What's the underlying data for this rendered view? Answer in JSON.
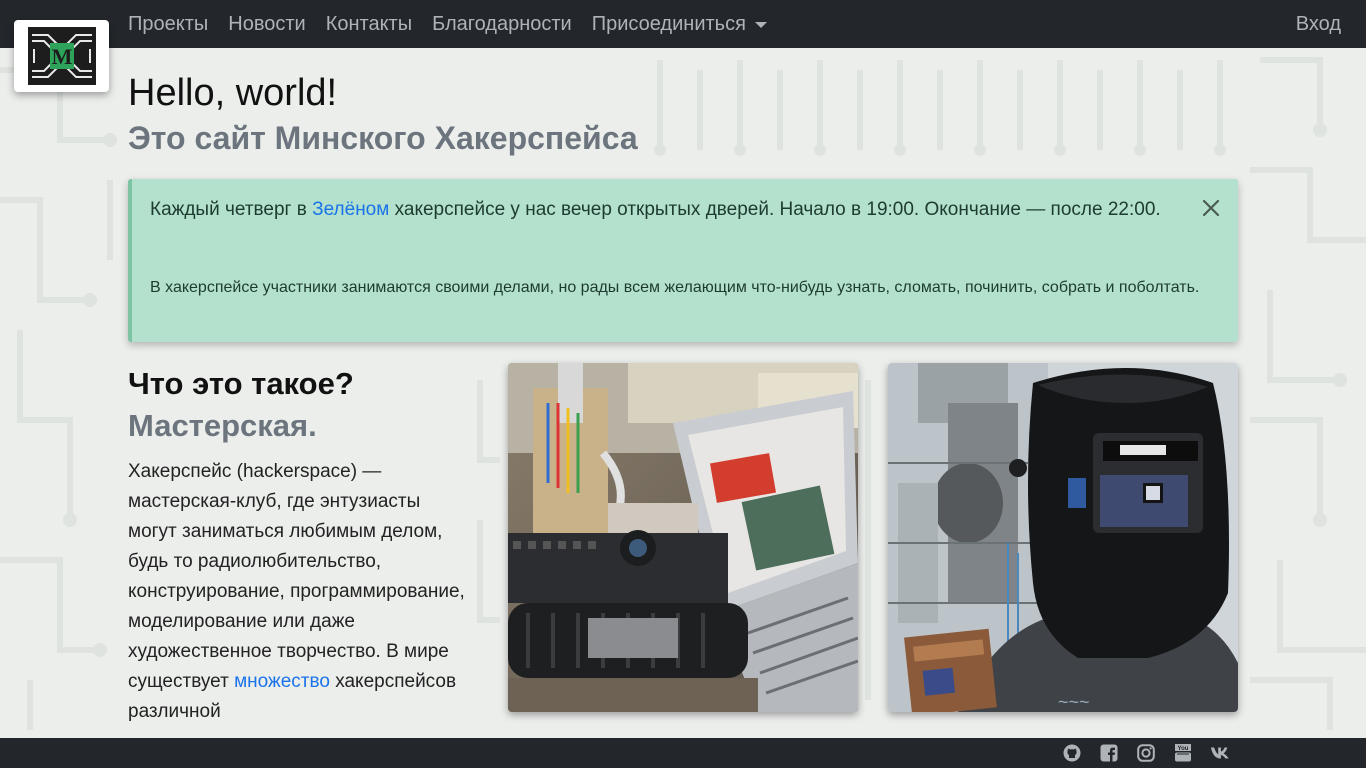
{
  "nav": {
    "items": [
      {
        "label": "Проекты"
      },
      {
        "label": "Новости"
      },
      {
        "label": "Контакты"
      },
      {
        "label": "Благодарности"
      },
      {
        "label": "Присоединиться"
      }
    ],
    "login": "Вход"
  },
  "logo": {
    "letter": "M"
  },
  "hero": {
    "title": "Hello, world!",
    "subtitle": "Это сайт Минского Хакерспейса"
  },
  "alert": {
    "p1_before": "Каждый четверг в ",
    "p1_link": "Зелёном",
    "p1_after": " хакерспейсе у нас вечер открытых дверей. Начало в 19:00. Окончание — после 22:00.",
    "p2": "В хакерспейсе участники занимаются своими делами, но рады всем желающим что-нибудь узнать, сломать, починить, собрать и поболтать."
  },
  "about": {
    "heading": "Что это такое?",
    "subheading": "Мастерская.",
    "text_before": "Хакерспейс (hackerspace) — мастерская-клуб, где энтузиасты могут заниматься любимым делом, будь то радиолюбительство, конструирование, программирование, моделирование или даже художественное творчество. В мире существует ",
    "text_link": "множество",
    "text_after": " хакерспейсов различной"
  },
  "footer": {
    "icons": [
      "github-icon",
      "facebook-icon",
      "instagram-icon",
      "youtube-icon",
      "vk-icon"
    ]
  },
  "colors": {
    "navbar": "#23272b",
    "nav_text": "#aeb3b8",
    "alert_bg": "#aee0ca",
    "link": "#1a73e8",
    "logo_green": "#2ea35a"
  }
}
